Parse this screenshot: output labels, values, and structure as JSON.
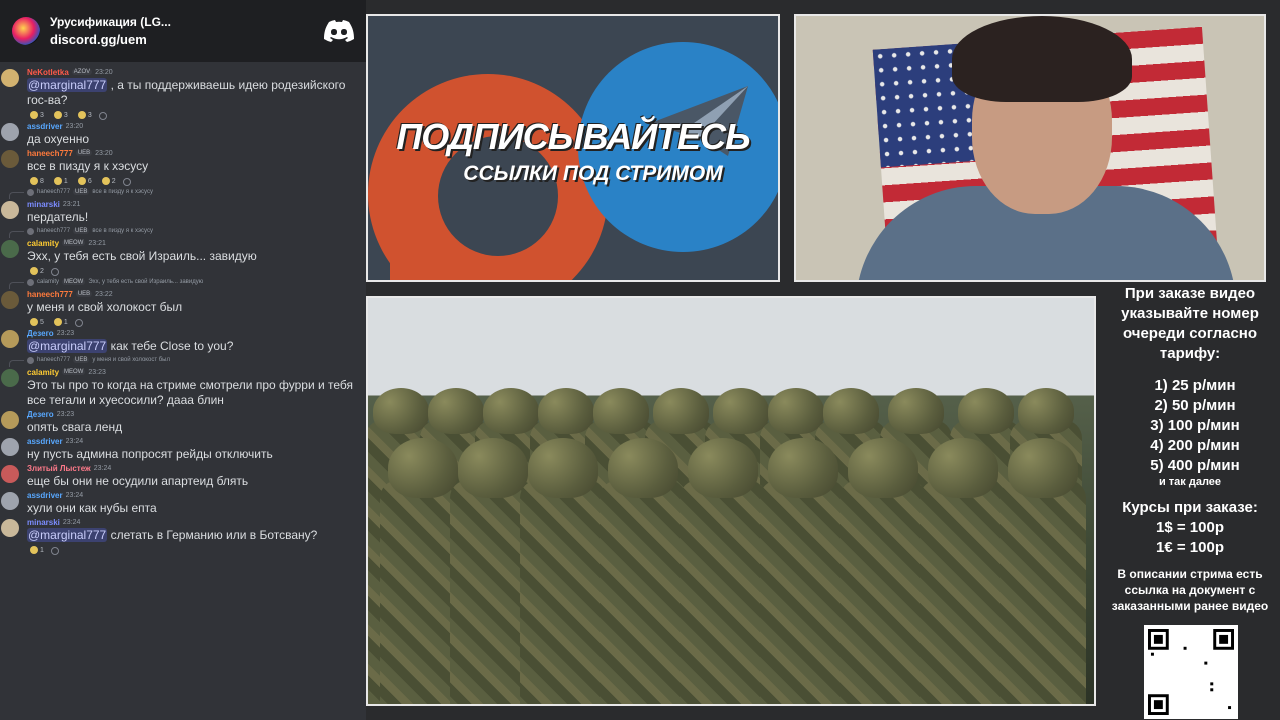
{
  "chat": {
    "server_name": "Урусификация (LG...",
    "server_link": "discord.gg/uem",
    "messages": [
      {
        "type": "msg",
        "user": "NeKotletka",
        "color": "#ff5a4a",
        "tag": "AZOV",
        "time": "23:20",
        "text": "@marginal777 , а ты поддерживаешь идею родезийского гос-ва?",
        "mention": "@marginal777",
        "rest": " , а ты поддерживаешь идею родезийского гос-ва?",
        "reactions": [
          "3",
          "3",
          "3"
        ],
        "avatar": "#d2b270"
      },
      {
        "type": "msg",
        "user": "assdriver",
        "color": "#58a8ff",
        "time": "23:20",
        "text": "да охуенно",
        "avatar": "#9ea3ad"
      },
      {
        "type": "msg",
        "user": "haneech777",
        "color": "#ff7a3c",
        "tag": "UEB",
        "time": "23:20",
        "text": "все в пизду я к хэсусу",
        "reactions": [
          "8",
          "1",
          "6",
          "2"
        ],
        "avatar": "#6a5a3a"
      },
      {
        "type": "reply",
        "user": "haneech777",
        "tag": "UEB",
        "text": "все в пизду я к хэсусу"
      },
      {
        "type": "msg",
        "user": "minarski",
        "color": "#7b8cff",
        "time": "23:21",
        "text": "пердатель!",
        "avatar": "#c9b89a"
      },
      {
        "type": "reply",
        "user": "haneech777",
        "tag": "UEB",
        "text": "все в пизду я к хэсусу"
      },
      {
        "type": "msg",
        "user": "calamity",
        "color": "#ffcc33",
        "tag": "MEOW",
        "time": "23:21",
        "text": "Эхх, у тебя есть свой Израиль... завидую",
        "reactions": [
          "2"
        ],
        "avatar": "#4a6a4a"
      },
      {
        "type": "reply",
        "user": "calamity",
        "tag": "MEOW",
        "text": "Эхх, у тебя есть свой Израиль... завидую"
      },
      {
        "type": "msg",
        "user": "haneech777",
        "color": "#ff7a3c",
        "tag": "UEB",
        "time": "23:22",
        "text": "у меня и свой холокост был",
        "reactions": [
          "5",
          "1"
        ],
        "avatar": "#6a5a3a"
      },
      {
        "type": "msg",
        "user": "Дезего",
        "color": "#58a8ff",
        "time": "23:23",
        "text": "@marginal777 как тебе Close to you?",
        "mention": "@marginal777",
        "rest": " как тебе Close to you?",
        "avatar": "#b59a5a"
      },
      {
        "type": "reply",
        "user": "haneech777",
        "tag": "UEB",
        "text": "у меня и свой холокост был"
      },
      {
        "type": "msg",
        "user": "calamity",
        "color": "#ffcc33",
        "tag": "MEOW",
        "time": "23:23",
        "text": "Это ты про то когда на стриме смотрели про фурри и тебя все тегали и хуесосили? дааа блин",
        "avatar": "#4a6a4a"
      },
      {
        "type": "msg",
        "user": "Дезего",
        "color": "#58a8ff",
        "time": "23:23",
        "text": "опять свага ленд",
        "avatar": "#b59a5a"
      },
      {
        "type": "msg",
        "user": "assdriver",
        "color": "#58a8ff",
        "time": "23:24",
        "text": "ну пусть админа попросят рейды отключить",
        "avatar": "#9ea3ad"
      },
      {
        "type": "msg",
        "user": "Злитый Лыстеж",
        "color": "#ff7a8a",
        "time": "23:24",
        "text": "еще бы они не осудили апартеид блять",
        "avatar": "#c85a5a"
      },
      {
        "type": "msg",
        "user": "assdriver",
        "color": "#58a8ff",
        "time": "23:24",
        "text": "хули они как нубы епта",
        "avatar": "#9ea3ad"
      },
      {
        "type": "msg",
        "user": "minarski",
        "color": "#7b8cff",
        "time": "23:24",
        "text": "@marginal777 слетать в Германию или в Ботсвану?",
        "mention": "@marginal777",
        "rest": " слетать в Германию или в Ботсвану?",
        "reactions": [
          "1"
        ],
        "avatar": "#c9b89a"
      }
    ]
  },
  "promo": {
    "title": "ПОДПИСЫВАЙТЕСЬ",
    "subtitle": "ССЫЛКИ ПОД СТРИМОМ"
  },
  "info": {
    "order": "При заказе видео указывайте номер очереди согласно тарифу:",
    "tariffs": [
      "1) 25 р/мин",
      "2) 50 р/мин",
      "3) 100 р/мин",
      "4) 200 р/мин",
      "5) 400 р/мин"
    ],
    "etc": "и так далее",
    "courses_title": "Курсы при заказе:",
    "rates": [
      "1$ = 100р",
      "1€ = 100р"
    ],
    "description": "В описании стрима есть ссылка на документ с заказанными ранее видео"
  },
  "colors": {
    "discord_bg": "#313338",
    "header_bg": "#1e1f22",
    "mention_bg": "#3c4270",
    "page_bg": "#2a2b2d"
  }
}
